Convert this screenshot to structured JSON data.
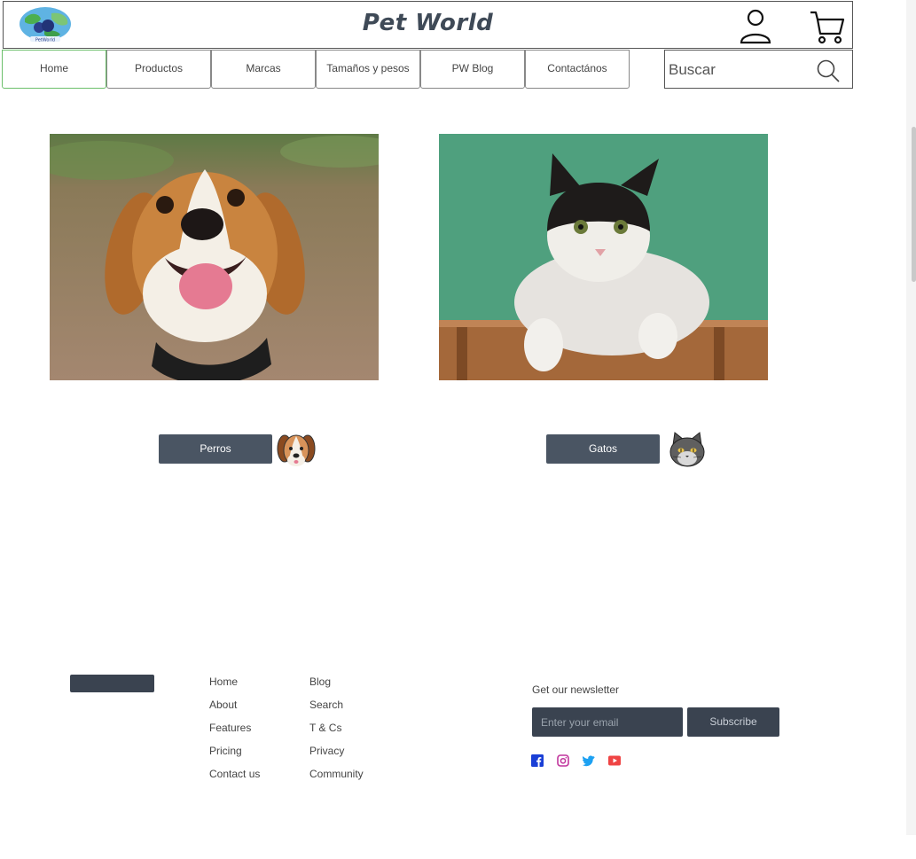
{
  "header": {
    "brand": "Pet World",
    "logo_icon": "petworld-globe-logo",
    "user_icon": "user-icon",
    "cart_icon": "cart-icon"
  },
  "nav": {
    "items": [
      {
        "label": "Home",
        "active": true
      },
      {
        "label": "Productos",
        "active": false
      },
      {
        "label": "Marcas",
        "active": false
      },
      {
        "label": "Tamaños y pesos",
        "active": false
      },
      {
        "label": "PW Blog",
        "active": false
      },
      {
        "label": "Contactános",
        "active": false
      }
    ],
    "active_color": "#6bbf6a"
  },
  "search": {
    "placeholder": "Buscar",
    "icon": "search-icon"
  },
  "categories": [
    {
      "label": "Perros",
      "icon": "dog-face-icon"
    },
    {
      "label": "Gatos",
      "icon": "cat-face-icon"
    }
  ],
  "footer": {
    "links_col1": [
      "Home",
      "About",
      "Features",
      "Pricing",
      "Contact us"
    ],
    "links_col2": [
      "Blog",
      "Search",
      "T & Cs",
      "Privacy",
      "Community"
    ],
    "newsletter_title": "Get our newsletter",
    "email_placeholder": "Enter your email",
    "subscribe_label": "Subscribe",
    "social": [
      {
        "icon": "facebook-icon",
        "color": "#1a3fd6"
      },
      {
        "icon": "instagram-icon",
        "color": "#c1359d"
      },
      {
        "icon": "twitter-icon",
        "color": "#1da1f2"
      },
      {
        "icon": "youtube-icon",
        "color": "#ef4444"
      }
    ]
  },
  "colors": {
    "button_bg": "#4a5563",
    "footer_dark": "#3a4350"
  }
}
